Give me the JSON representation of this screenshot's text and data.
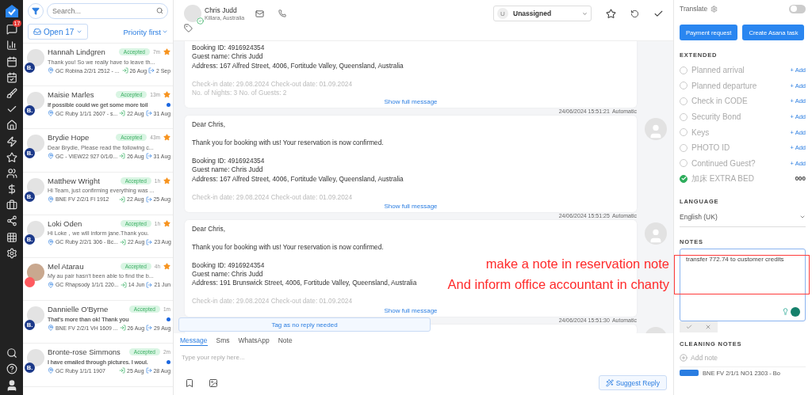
{
  "nav": {
    "chat_badge": "17"
  },
  "list": {
    "search": {
      "placeholder": "Search..."
    },
    "filter": {
      "label": "Open",
      "count": "17"
    },
    "sort": "Priority first",
    "conversations": [
      {
        "name": "Hannah Lindgren",
        "status": "Accepted",
        "time": "7m",
        "starred": true,
        "unread": false,
        "kind": "booking",
        "badge": "B.",
        "preview": "Thank you! So we really have to leave th...",
        "property": "GC Robina 2/2/1 2512 - ...",
        "checkin": "26 Aug",
        "checkout": "2 Sep"
      },
      {
        "name": "Maisie Marles",
        "status": "Accepted",
        "time": "13m",
        "starred": true,
        "unread": true,
        "kind": "booking",
        "badge": "B.",
        "preview": "If possible could we get some more toil",
        "property": "GC Ruby 1/1/1 2607 - s...",
        "checkin": "22 Aug",
        "checkout": "31 Aug"
      },
      {
        "name": "Brydie Hope",
        "status": "Accepted",
        "time": "43m",
        "starred": true,
        "unread": false,
        "kind": "booking",
        "badge": "B.",
        "preview": "Dear Brydie, Please read the following c...",
        "property": "GC - VIEW22 927 0/1/0...",
        "checkin": "26 Aug",
        "checkout": "31 Aug"
      },
      {
        "name": "Matthew Wright",
        "status": "Accepted",
        "time": "1h",
        "starred": true,
        "unread": false,
        "kind": "booking",
        "badge": "B.",
        "preview": "Hi Team, just confirming everything was ...",
        "property": "BNE FV 2/2/1 FI 1912",
        "checkin": "22 Aug",
        "checkout": "25 Aug"
      },
      {
        "name": "Loki Oden",
        "status": "Accepted",
        "time": "1h",
        "starred": true,
        "unread": false,
        "kind": "booking",
        "badge": "B.",
        "preview": "Hi Loke，we will inform jane.Thank you.",
        "property": "GC Ruby 2/2/1 306 - Bc...",
        "checkin": "22 Aug",
        "checkout": "23 Aug"
      },
      {
        "name": "Mel Atarau",
        "status": "Accepted",
        "time": "4h",
        "starred": true,
        "unread": false,
        "kind": "airbnb",
        "preview": "My au pair hasn't been able to find the b...",
        "property": "GC Rhapsody 1/1/1 220...",
        "checkin": "14 Jun",
        "checkout": "21 Jun"
      },
      {
        "name": "Dannielle O'Byrne",
        "status": "Accepted",
        "time": "1m",
        "starred": false,
        "unread": true,
        "kind": "booking",
        "badge": "B.",
        "preview": "That's more than ok! Thank you",
        "property": "BNE FV 2/2/1 VH 1609 ...",
        "checkin": "26 Aug",
        "checkout": "29 Aug"
      },
      {
        "name": "Bronte-rose Simmons",
        "status": "Accepted",
        "time": "2m",
        "starred": false,
        "unread": true,
        "kind": "booking",
        "badge": "B.",
        "preview": "I have emailed through pictures. I woul.",
        "property": "GC Ruby 1/1/1 1907",
        "checkin": "25 Aug",
        "checkout": "28 Aug"
      }
    ]
  },
  "header": {
    "name": "Chris Judd",
    "location": "Killara, Australia",
    "verified": true,
    "assignee_initial": "U",
    "assignee": "Unassigned"
  },
  "messages": [
    {
      "paragraphs": [
        [
          "Booking ID: 4916924354",
          "Guest name: Chris Judd",
          "Address: 167 Alfred Street, 4006, Fortitude Valley, Queensland, Australia"
        ]
      ],
      "faded": [
        "Check-in date: 29.08.2024 Check-out date: 01.09.2024",
        "No. of Nights: 3 No. of Guests: 2"
      ],
      "show_more": "Show full message"
    },
    {
      "timestamp": "24/06/2024 15:51:21",
      "source": "Automatic",
      "paragraphs": [
        [
          "Dear Chris,"
        ],
        [
          "Thank you for booking with us! Your reservation is now confirmed."
        ],
        [
          "Booking ID: 4916924354",
          "Guest name: Chris Judd",
          "Address: 167 Alfred Street, 4006, Fortitude Valley, Queensland, Australia"
        ]
      ],
      "faded": [
        "Check-in date: 29.08.2024 Check-out date: 01.09.2024"
      ],
      "show_more": "Show full message"
    },
    {
      "timestamp": "24/06/2024 15:51:25",
      "source": "Automatic",
      "paragraphs": [
        [
          "Dear Chris,"
        ],
        [
          "Thank you for booking with us! Your reservation is now confirmed."
        ],
        [
          "Booking ID: 4916924354",
          "Guest name: Chris Judd",
          "Address: 191 Brunswick Street, 4006, Fortitude Valley, Queensland, Australia"
        ]
      ],
      "faded": [
        "Check-in date: 29.08.2024 Check-out date: 01.09.2024"
      ],
      "show_more": "Show full message"
    },
    {
      "timestamp": "24/06/2024 15:51:30",
      "source": "Automatic"
    }
  ],
  "tag_bar": "Tag as no reply needed",
  "composer": {
    "tabs": [
      {
        "label": "Message",
        "selected": true
      },
      {
        "label": "Sms",
        "selected": false
      },
      {
        "label": "WhatsApp",
        "selected": false
      },
      {
        "label": "Note",
        "selected": false
      }
    ],
    "placeholder": "Type your reply here...",
    "suggest": "Suggest Reply"
  },
  "panel": {
    "translate": {
      "label": "Translate",
      "on": false
    },
    "buttons": [
      "Payment request",
      "Create Asana task"
    ],
    "extended": {
      "title": "EXTENDED",
      "items": [
        {
          "label": "Planned arrival",
          "checked": false,
          "kind": "add",
          "text": "+ Add"
        },
        {
          "label": "Planned departure",
          "checked": false,
          "kind": "add",
          "text": "+ Add"
        },
        {
          "label": "Check in CODE",
          "checked": false,
          "kind": "add",
          "text": "+ Add"
        },
        {
          "label": "Security Bond",
          "checked": false,
          "kind": "add",
          "text": "+ Add"
        },
        {
          "label": "Keys",
          "checked": false,
          "kind": "add",
          "text": "+ Add"
        },
        {
          "label": "PHOTO ID",
          "checked": false,
          "kind": "add",
          "text": "+ Add"
        },
        {
          "label": "Continued Guest?",
          "checked": false,
          "kind": "add",
          "text": "+ Add"
        },
        {
          "label": "加床 EXTRA BED",
          "checked": true,
          "kind": "value",
          "text": "000"
        }
      ]
    },
    "language": {
      "title": "LANGUAGE",
      "value": "English (UK)"
    },
    "notes": {
      "title": "NOTES",
      "value": "transfer 772.74 to customer credits"
    },
    "cleaning": {
      "title": "CLEANING NOTES",
      "add": "Add note",
      "item": "BNE FV 2/1/1 NO1 2303 - Bo"
    }
  },
  "annotation": {
    "lines": [
      "make a note in reservation note",
      "And inform office accountant in chanty"
    ]
  }
}
